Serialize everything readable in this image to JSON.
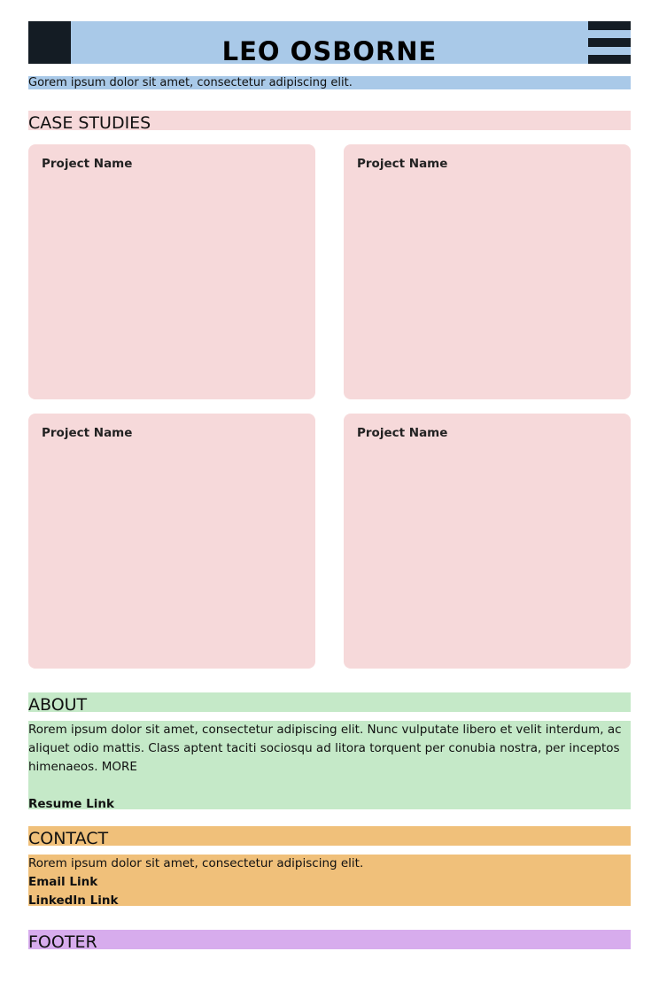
{
  "header": {
    "title": "LEO OSBORNE",
    "tagline": "Gorem ipsum dolor sit amet, consectetur adipiscing elit."
  },
  "case_studies": {
    "heading": "CASE STUDIES",
    "projects": [
      {
        "name": "Project Name"
      },
      {
        "name": "Project Name"
      },
      {
        "name": "Project Name"
      },
      {
        "name": "Project Name"
      }
    ]
  },
  "about": {
    "heading": "ABOUT",
    "text": "Rorem ipsum dolor sit amet, consectetur adipiscing elit. Nunc vulputate libero et velit interdum, ac aliquet odio mattis. Class aptent taciti sociosqu ad litora torquent per conubia nostra, per inceptos himenaeos.",
    "more_label": "MORE",
    "resume_link": "Resume Link"
  },
  "contact": {
    "heading": "CONTACT",
    "text": "Rorem ipsum dolor sit amet, consectetur adipiscing elit.",
    "email_link": "Email Link",
    "linkedin_link": "LinkedIn Link"
  },
  "footer": {
    "heading": "FOOTER"
  },
  "colors": {
    "header_bg": "#a9c9e8",
    "dark_block": "#141c24",
    "case_studies_bg": "#f6d9da",
    "about_bg": "#c5e9c8",
    "contact_bg": "#f0c07a",
    "footer_bg": "#d7aced"
  },
  "icons": {
    "logo": "logo-block",
    "menu": "hamburger-menu-icon"
  }
}
